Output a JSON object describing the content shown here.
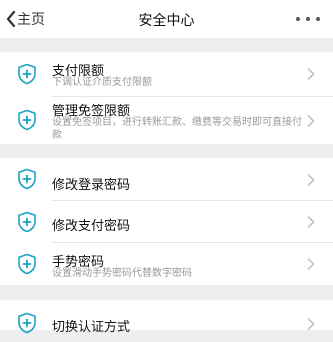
{
  "nav": {
    "back_label": "主页",
    "title": "安全中心"
  },
  "groups": [
    {
      "items": [
        {
          "label": "支付限额",
          "sub": "下调认证介质支付限额"
        },
        {
          "label": "管理免签限额",
          "sub": "设置免签项目，进行转账汇款、缴费等交易时即可直接付款"
        }
      ]
    },
    {
      "items": [
        {
          "label": "修改登录密码"
        },
        {
          "label": "修改支付密码"
        },
        {
          "label": "手势密码",
          "sub": "设置滑动手势密码代替数字密码"
        }
      ]
    },
    {
      "items": [
        {
          "label": "切换认证方式"
        }
      ]
    }
  ],
  "colors": {
    "icon_accent": "#1aa3c4",
    "background": "#eeeeee",
    "chevron": "#c4c4c4"
  },
  "icons": {
    "back": "chevron-left",
    "more": "ellipsis",
    "row": "shield-plus",
    "row_arrow": "chevron-right"
  }
}
